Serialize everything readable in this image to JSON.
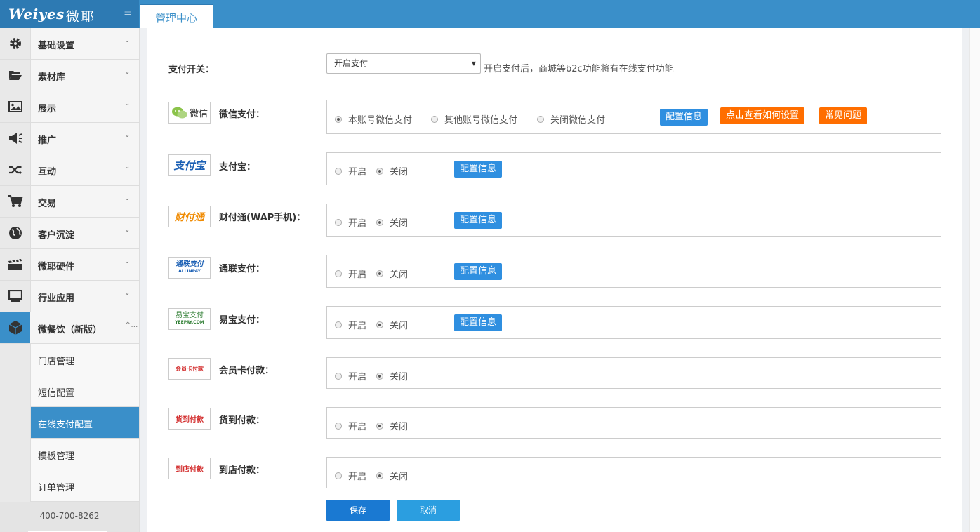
{
  "header": {
    "brand": "Weiyes",
    "brand_cn": "微耶",
    "menu_icon": "hamburger-icon",
    "tab": "管理中心"
  },
  "sidebar": {
    "items": [
      {
        "label": "基础设置",
        "icon": "gear-icon"
      },
      {
        "label": "素材库",
        "icon": "folder-open-icon"
      },
      {
        "label": "展示",
        "icon": "picture-icon"
      },
      {
        "label": "推广",
        "icon": "megaphone-icon"
      },
      {
        "label": "互动",
        "icon": "shuffle-icon"
      },
      {
        "label": "交易",
        "icon": "cart-icon"
      },
      {
        "label": "客户沉淀",
        "icon": "globe-icon"
      },
      {
        "label": "微耶硬件",
        "icon": "film-icon"
      },
      {
        "label": "行业应用",
        "icon": "monitor-icon"
      },
      {
        "label": "微餐饮（新版）",
        "icon": "cube-icon"
      }
    ],
    "sub_items": [
      {
        "label": "门店管理"
      },
      {
        "label": "短信配置"
      },
      {
        "label": "在线支付配置"
      },
      {
        "label": "模板管理"
      },
      {
        "label": "订单管理"
      }
    ],
    "phone": "400-700-8262"
  },
  "form": {
    "switch_label": "支付开关：",
    "switch_value": "开启支付",
    "switch_hint": "开启支付后，商城等b2c功能将有在线支付功能",
    "wechat": {
      "logo_text": "微信",
      "label": "微信支付：",
      "options": [
        "本账号微信支付",
        "其他账号微信支付",
        "关闭微信支付"
      ],
      "selected": 0,
      "btn_config": "配置信息",
      "btn_howto": "点击查看如何设置",
      "btn_faq": "常见问题"
    },
    "rows": [
      {
        "logo_text": "支付宝",
        "label": "支付宝：",
        "on": "开启",
        "off": "关闭",
        "config": "配置信息"
      },
      {
        "logo_text": "财付通",
        "label": "财付通(WAP手机)：",
        "on": "开启",
        "off": "关闭",
        "config": "配置信息"
      },
      {
        "logo_text": "通联支付",
        "logo_sub": "ALLINPAY",
        "label": "通联支付：",
        "on": "开启",
        "off": "关闭",
        "config": "配置信息"
      },
      {
        "logo_text": "易宝支付",
        "logo_sub": "YEEPAY.COM",
        "label": "易宝支付：",
        "on": "开启",
        "off": "关闭",
        "config": "配置信息"
      },
      {
        "logo_text": "会员卡付款",
        "label": "会员卡付款：",
        "on": "开启",
        "off": "关闭"
      },
      {
        "logo_text": "货到付款",
        "label": "货到付款：",
        "on": "开启",
        "off": "关闭"
      },
      {
        "logo_text": "到店付款",
        "label": "到店付款：",
        "on": "开启",
        "off": "关闭"
      }
    ],
    "save": "保存",
    "cancel": "取消"
  },
  "colors": {
    "topbar": "#3a8fc9",
    "accent_blue": "#2f8fe0",
    "accent_orange": "#ff6e00"
  }
}
